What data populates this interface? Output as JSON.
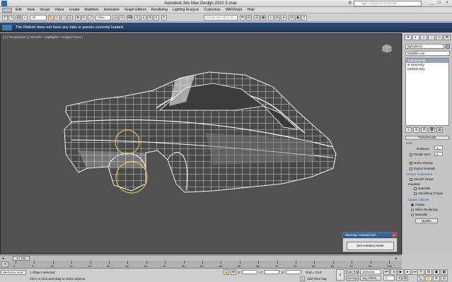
{
  "app": {
    "logo_letter": "",
    "title": "Autodesk 3ds Max Design 2010      2.max",
    "search_placeholder": "Type a keyword or phrase"
  },
  "window_controls": [
    "_",
    "□",
    "×"
  ],
  "menu": [
    "Edit",
    "Tools",
    "Group",
    "Views",
    "Create",
    "Modifiers",
    "Animation",
    "Graph Editors",
    "Rendering",
    "Lighting Analysis",
    "Customize",
    "MAXScript",
    "Help"
  ],
  "toolbar": {
    "filter_value": "All",
    "ref_coord_value": "View",
    "selection_set_placeholder": "Create Selection Se"
  },
  "ribbon": {
    "message": "The Ribbon does not have any tabs or panels currently loaded."
  },
  "viewport": {
    "label": "[+] [ Perspective ] [ Smooth + Highlights + Edged Faces ]"
  },
  "warning_dialog": {
    "title": "Warning: Isolated Sel...",
    "close": "×",
    "button_label": "Exit Isolation Mode"
  },
  "command_panel": {
    "object_name": "Cylinder01",
    "modifier_list": "Modifier List",
    "stack_items": [
      "TurboSmooth",
      "Symmetry",
      "Editable Poly"
    ],
    "rollout_title": "TurboSmooth",
    "main_label": "Main",
    "iterations_label": "Iterations:",
    "iterations_value": "1",
    "render_iters_label": "Render Iters:",
    "render_iters_value": "0",
    "isoline_label": "Isoline Display",
    "explicit_normals_label": "Explicit Normals",
    "surface_params_label": "Surface Parameters",
    "smooth_result_label": "Smooth Result",
    "separate_label": "Separate",
    "materials_label": "Materials",
    "smoothing_groups_label": "Smoothing Groups",
    "update_options_label": "Update Options",
    "always_label": "Always",
    "when_rendering_label": "When Rendering",
    "manually_label": "Manually",
    "update_button": "Update"
  },
  "timeline": {
    "frame_display": "0 / 100",
    "ticks": [
      "0",
      "5",
      "10",
      "15",
      "20",
      "25",
      "30",
      "35",
      "40",
      "45",
      "50",
      "55",
      "60",
      "65",
      "70",
      "75",
      "80",
      "85",
      "90",
      "95",
      "100"
    ]
  },
  "status": {
    "welcome": "Welcome to M",
    "selected_text": "1 Object Selected",
    "prompt_text": "Click or click-and-drag to select objects",
    "x_label": "X:",
    "y_label": "Y:",
    "z_label": "Z:",
    "grid_text": "Grid = 10.0",
    "add_time_tag": "Add Time Tag",
    "auto_key": "Auto Key",
    "set_key": "Set Key",
    "selected_dropdown": "Selected",
    "key_filters": "Key Filters...",
    "frame_value": "0"
  }
}
